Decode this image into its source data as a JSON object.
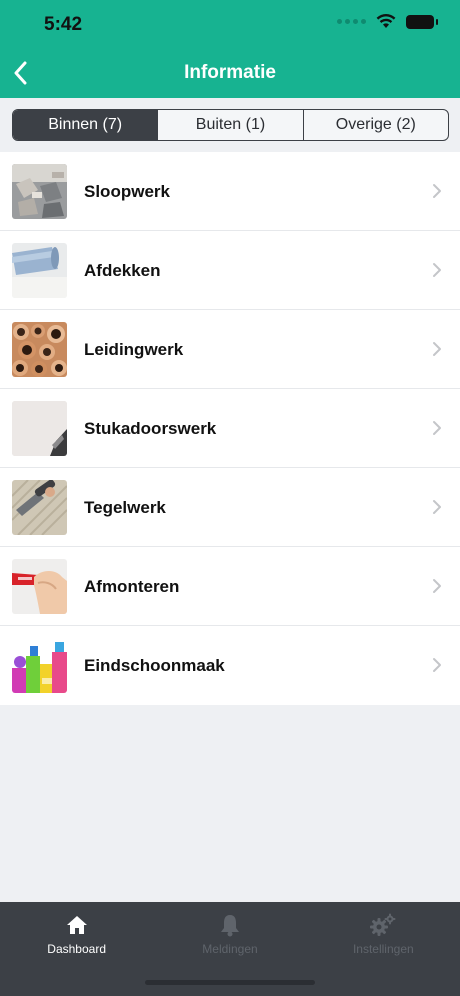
{
  "status_bar": {
    "time": "5:42"
  },
  "nav": {
    "title": "Informatie"
  },
  "segments": [
    {
      "label": "Binnen (7)",
      "active": true
    },
    {
      "label": "Buiten (1)",
      "active": false
    },
    {
      "label": "Overige (2)",
      "active": false
    }
  ],
  "items": [
    {
      "label": "Sloopwerk",
      "thumb_icon": "demolition-rubble-image"
    },
    {
      "label": "Afdekken",
      "thumb_icon": "covering-roll-image"
    },
    {
      "label": "Leidingwerk",
      "thumb_icon": "copper-pipes-image"
    },
    {
      "label": "Stukadoorswerk",
      "thumb_icon": "plaster-wall-image"
    },
    {
      "label": "Tegelwerk",
      "thumb_icon": "tile-adhesive-image"
    },
    {
      "label": "Afmonteren",
      "thumb_icon": "hand-mounting-image"
    },
    {
      "label": "Eindschoonmaak",
      "thumb_icon": "cleaning-supplies-image"
    }
  ],
  "tabbar": {
    "tabs": [
      {
        "label": "Dashboard",
        "icon": "home-icon",
        "active": true
      },
      {
        "label": "Meldingen",
        "icon": "bell-icon",
        "active": false
      },
      {
        "label": "Instellingen",
        "icon": "gears-icon",
        "active": false
      }
    ]
  },
  "colors": {
    "header": "#17b391",
    "segment_active": "#3c4046",
    "tabbar": "#3c4046",
    "background": "#eef0f3"
  }
}
